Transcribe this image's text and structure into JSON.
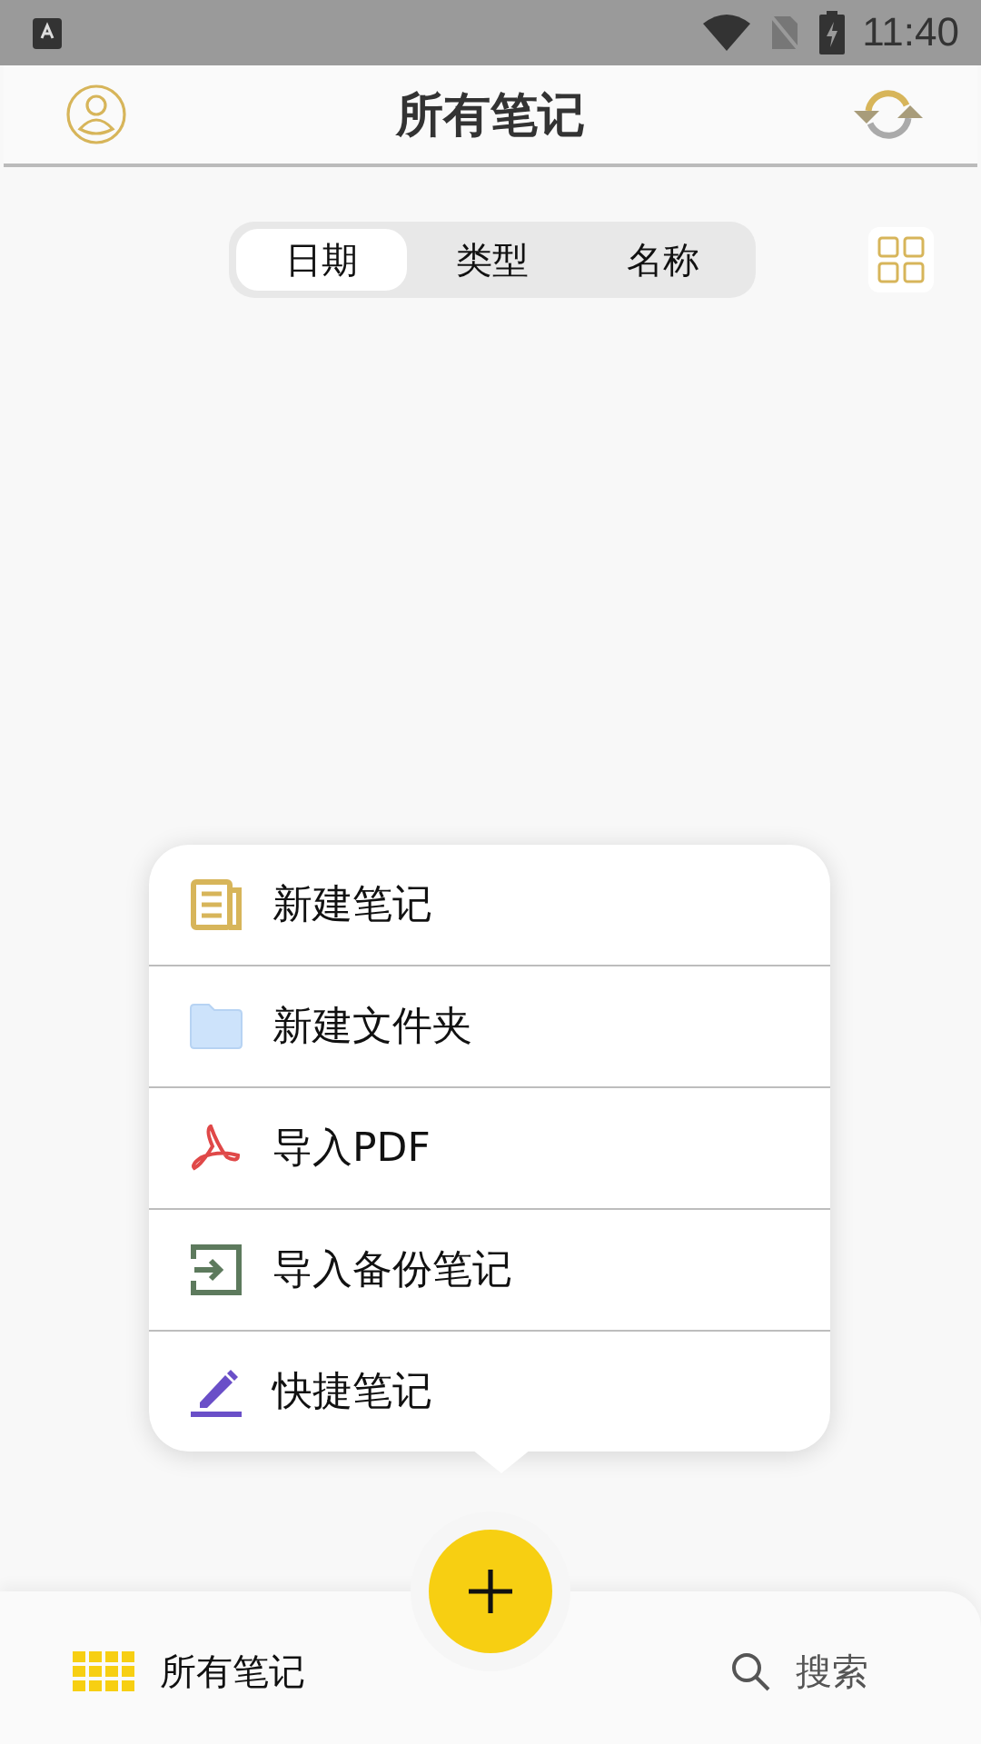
{
  "status_bar": {
    "time": "11:40"
  },
  "header": {
    "title": "所有笔记"
  },
  "sort_tabs": [
    {
      "label": "日期",
      "selected": true
    },
    {
      "label": "类型",
      "selected": false
    },
    {
      "label": "名称",
      "selected": false
    }
  ],
  "menu": [
    {
      "kind": "note",
      "label": "新建笔记"
    },
    {
      "kind": "folder",
      "label": "新建文件夹"
    },
    {
      "kind": "pdf",
      "label": "导入PDF"
    },
    {
      "kind": "import",
      "label": "导入备份笔记"
    },
    {
      "kind": "quick",
      "label": "快捷笔记"
    }
  ],
  "bottom_nav": [
    {
      "kind": "notes",
      "label": "所有笔记",
      "selected": true
    },
    {
      "kind": "search",
      "label": "搜索",
      "selected": false
    }
  ]
}
